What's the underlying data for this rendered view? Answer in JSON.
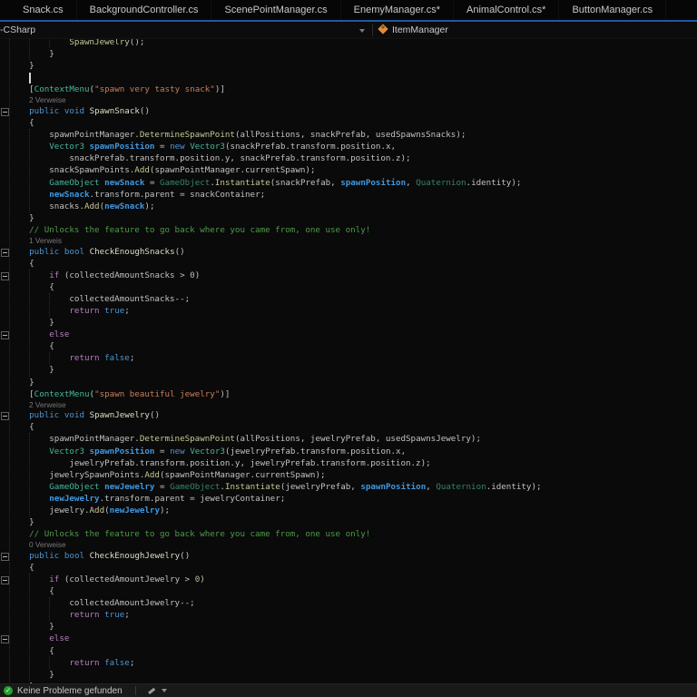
{
  "tab_bar": {
    "tabs": [
      {
        "label": "Snack.cs"
      },
      {
        "label": "BackgroundController.cs"
      },
      {
        "label": "ScenePointManager.cs"
      },
      {
        "label": "EnemyManager.cs*"
      },
      {
        "label": "AnimalControl.cs*"
      },
      {
        "label": "ButtonManager.cs"
      }
    ]
  },
  "nav_bar": {
    "project_dropdown": "-CSharp",
    "type_dropdown": "ItemManager"
  },
  "status_bar": {
    "message": "Keine Probleme gefunden"
  },
  "colors": {
    "accent_blue": "#1d59a6",
    "class_icon_orange": "#dd8f3d",
    "status_green": "#27a12f",
    "tokens": {
      "p": "#c2c2c2",
      "k": "#4e94cf",
      "c": "#b77fc1",
      "t": "#45b89c",
      "td": "#37836f",
      "m": "#c6c795",
      "md": "#dedec8",
      "l": "#4098e0",
      "s": "#c77d5f",
      "cm": "#4e9a4a",
      "n": "#a9c49a",
      "lens": "#787878"
    }
  },
  "editor": {
    "caret_line": 4,
    "fold_lines": [
      7,
      19,
      21,
      26,
      33,
      45,
      47,
      52
    ],
    "guides": [
      {
        "col": 0,
        "from": 1,
        "to": null
      },
      {
        "col": 4,
        "from": 1,
        "to": 3
      },
      {
        "col": 8,
        "from": 1,
        "to": 2
      },
      {
        "col": 4,
        "from": 9,
        "to": 16
      },
      {
        "col": 4,
        "from": 21,
        "to": 30
      },
      {
        "col": 4,
        "from": 35,
        "to": 42
      },
      {
        "col": 4,
        "from": 47,
        "to": 56
      },
      {
        "col": 8,
        "from": 23,
        "to": 25
      },
      {
        "col": 8,
        "from": 28,
        "to": 29
      },
      {
        "col": 8,
        "from": 49,
        "to": 51
      },
      {
        "col": 8,
        "from": 54,
        "to": 55
      }
    ],
    "lines": [
      {
        "kind": "code",
        "tokens": [
          [
            "p",
            "            "
          ],
          [
            "m",
            "SpawnJewelry"
          ],
          [
            "p",
            "();"
          ]
        ]
      },
      {
        "kind": "code",
        "tokens": [
          [
            "p",
            "        }"
          ]
        ]
      },
      {
        "kind": "code",
        "tokens": [
          [
            "p",
            "    }"
          ]
        ]
      },
      {
        "kind": "code",
        "tokens": []
      },
      {
        "kind": "code",
        "tokens": [
          [
            "p",
            "    ["
          ],
          [
            "t",
            "ContextMenu"
          ],
          [
            "p",
            "("
          ],
          [
            "s",
            "\"spawn very tasty snack\""
          ],
          [
            "p",
            ")]"
          ]
        ]
      },
      {
        "kind": "lens",
        "text": "2 Verweise"
      },
      {
        "kind": "code",
        "tokens": [
          [
            "p",
            "    "
          ],
          [
            "k",
            "public"
          ],
          [
            "p",
            " "
          ],
          [
            "k",
            "void"
          ],
          [
            "p",
            " "
          ],
          [
            "md",
            "SpawnSnack"
          ],
          [
            "p",
            "()"
          ]
        ]
      },
      {
        "kind": "code",
        "tokens": [
          [
            "p",
            "    {"
          ]
        ]
      },
      {
        "kind": "code",
        "tokens": [
          [
            "p",
            "        spawnPointManager."
          ],
          [
            "m",
            "DetermineSpawnPoint"
          ],
          [
            "p",
            "(allPositions, snackPrefab, usedSpawnsSnacks);"
          ]
        ]
      },
      {
        "kind": "code",
        "tokens": [
          [
            "p",
            "        "
          ],
          [
            "t",
            "Vector3"
          ],
          [
            "p",
            " "
          ],
          [
            "l",
            "spawnPosition"
          ],
          [
            "p",
            " = "
          ],
          [
            "k",
            "new"
          ],
          [
            "p",
            " "
          ],
          [
            "t",
            "Vector3"
          ],
          [
            "p",
            "(snackPrefab.transform.position.x,"
          ]
        ]
      },
      {
        "kind": "code",
        "tokens": [
          [
            "p",
            "            snackPrefab.transform.position.y, snackPrefab.transform.position.z);"
          ]
        ]
      },
      {
        "kind": "code",
        "tokens": [
          [
            "p",
            "        snackSpawnPoints."
          ],
          [
            "m",
            "Add"
          ],
          [
            "p",
            "(spawnPointManager.currentSpawn);"
          ]
        ]
      },
      {
        "kind": "code",
        "tokens": [
          [
            "p",
            "        "
          ],
          [
            "t",
            "GameObject"
          ],
          [
            "p",
            " "
          ],
          [
            "l",
            "newSnack"
          ],
          [
            "p",
            " = "
          ],
          [
            "td",
            "GameObject"
          ],
          [
            "p",
            "."
          ],
          [
            "m",
            "Instantiate"
          ],
          [
            "p",
            "(snackPrefab, "
          ],
          [
            "l",
            "spawnPosition"
          ],
          [
            "p",
            ", "
          ],
          [
            "td",
            "Quaternion"
          ],
          [
            "p",
            ".identity);"
          ]
        ]
      },
      {
        "kind": "code",
        "tokens": [
          [
            "p",
            "        "
          ],
          [
            "l",
            "newSnack"
          ],
          [
            "p",
            ".transform.parent = snackContainer;"
          ]
        ]
      },
      {
        "kind": "code",
        "tokens": [
          [
            "p",
            "        snacks."
          ],
          [
            "m",
            "Add"
          ],
          [
            "p",
            "("
          ],
          [
            "l",
            "newSnack"
          ],
          [
            "p",
            ");"
          ]
        ]
      },
      {
        "kind": "code",
        "tokens": [
          [
            "p",
            "    }"
          ]
        ]
      },
      {
        "kind": "code",
        "tokens": [
          [
            "cm",
            "    // Unlocks the feature to go back where you came from, one use only!"
          ]
        ]
      },
      {
        "kind": "lens",
        "text": "1 Verweis"
      },
      {
        "kind": "code",
        "tokens": [
          [
            "p",
            "    "
          ],
          [
            "k",
            "public"
          ],
          [
            "p",
            " "
          ],
          [
            "k",
            "bool"
          ],
          [
            "p",
            " "
          ],
          [
            "md",
            "CheckEnoughSnacks"
          ],
          [
            "p",
            "()"
          ]
        ]
      },
      {
        "kind": "code",
        "tokens": [
          [
            "p",
            "    {"
          ]
        ]
      },
      {
        "kind": "code",
        "tokens": [
          [
            "p",
            "        "
          ],
          [
            "c",
            "if"
          ],
          [
            "p",
            " (collectedAmountSnacks > "
          ],
          [
            "n",
            "0"
          ],
          [
            "p",
            ")"
          ]
        ]
      },
      {
        "kind": "code",
        "tokens": [
          [
            "p",
            "        {"
          ]
        ]
      },
      {
        "kind": "code",
        "tokens": [
          [
            "p",
            "            collectedAmountSnacks--;"
          ]
        ]
      },
      {
        "kind": "code",
        "tokens": [
          [
            "p",
            "            "
          ],
          [
            "c",
            "return"
          ],
          [
            "p",
            " "
          ],
          [
            "k",
            "true"
          ],
          [
            "p",
            ";"
          ]
        ]
      },
      {
        "kind": "code",
        "tokens": [
          [
            "p",
            "        }"
          ]
        ]
      },
      {
        "kind": "code",
        "tokens": [
          [
            "p",
            "        "
          ],
          [
            "c",
            "else"
          ]
        ]
      },
      {
        "kind": "code",
        "tokens": [
          [
            "p",
            "        {"
          ]
        ]
      },
      {
        "kind": "code",
        "tokens": [
          [
            "p",
            "            "
          ],
          [
            "c",
            "return"
          ],
          [
            "p",
            " "
          ],
          [
            "k",
            "false"
          ],
          [
            "p",
            ";"
          ]
        ]
      },
      {
        "kind": "code",
        "tokens": [
          [
            "p",
            "        }"
          ]
        ]
      },
      {
        "kind": "code",
        "tokens": [
          [
            "p",
            "    }"
          ]
        ]
      },
      {
        "kind": "code",
        "tokens": [
          [
            "p",
            "    ["
          ],
          [
            "t",
            "ContextMenu"
          ],
          [
            "p",
            "("
          ],
          [
            "s",
            "\"spawn beautiful jewelry\""
          ],
          [
            "p",
            ")]"
          ]
        ]
      },
      {
        "kind": "lens",
        "text": "2 Verweise"
      },
      {
        "kind": "code",
        "tokens": [
          [
            "p",
            "    "
          ],
          [
            "k",
            "public"
          ],
          [
            "p",
            " "
          ],
          [
            "k",
            "void"
          ],
          [
            "p",
            " "
          ],
          [
            "md",
            "SpawnJewelry"
          ],
          [
            "p",
            "()"
          ]
        ]
      },
      {
        "kind": "code",
        "tokens": [
          [
            "p",
            "    {"
          ]
        ]
      },
      {
        "kind": "code",
        "tokens": [
          [
            "p",
            "        spawnPointManager."
          ],
          [
            "m",
            "DetermineSpawnPoint"
          ],
          [
            "p",
            "(allPositions, jewelryPrefab, usedSpawnsJewelry);"
          ]
        ]
      },
      {
        "kind": "code",
        "tokens": [
          [
            "p",
            "        "
          ],
          [
            "t",
            "Vector3"
          ],
          [
            "p",
            " "
          ],
          [
            "l",
            "spawnPosition"
          ],
          [
            "p",
            " = "
          ],
          [
            "k",
            "new"
          ],
          [
            "p",
            " "
          ],
          [
            "t",
            "Vector3"
          ],
          [
            "p",
            "(jewelryPrefab.transform.position.x,"
          ]
        ]
      },
      {
        "kind": "code",
        "tokens": [
          [
            "p",
            "            jewelryPrefab.transform.position.y, jewelryPrefab.transform.position.z);"
          ]
        ]
      },
      {
        "kind": "code",
        "tokens": [
          [
            "p",
            "        jewelrySpawnPoints."
          ],
          [
            "m",
            "Add"
          ],
          [
            "p",
            "(spawnPointManager.currentSpawn);"
          ]
        ]
      },
      {
        "kind": "code",
        "tokens": [
          [
            "p",
            "        "
          ],
          [
            "t",
            "GameObject"
          ],
          [
            "p",
            " "
          ],
          [
            "l",
            "newJewelry"
          ],
          [
            "p",
            " = "
          ],
          [
            "td",
            "GameObject"
          ],
          [
            "p",
            "."
          ],
          [
            "m",
            "Instantiate"
          ],
          [
            "p",
            "(jewelryPrefab, "
          ],
          [
            "l",
            "spawnPosition"
          ],
          [
            "p",
            ", "
          ],
          [
            "td",
            "Quaternion"
          ],
          [
            "p",
            ".identity);"
          ]
        ]
      },
      {
        "kind": "code",
        "tokens": [
          [
            "p",
            "        "
          ],
          [
            "l",
            "newJewelry"
          ],
          [
            "p",
            ".transform.parent = jewelryContainer;"
          ]
        ]
      },
      {
        "kind": "code",
        "tokens": [
          [
            "p",
            "        jewelry."
          ],
          [
            "m",
            "Add"
          ],
          [
            "p",
            "("
          ],
          [
            "l",
            "newJewelry"
          ],
          [
            "p",
            ");"
          ]
        ]
      },
      {
        "kind": "code",
        "tokens": [
          [
            "p",
            "    }"
          ]
        ]
      },
      {
        "kind": "code",
        "tokens": [
          [
            "cm",
            "    // Unlocks the feature to go back where you came from, one use only!"
          ]
        ]
      },
      {
        "kind": "lens",
        "text": "0 Verweise"
      },
      {
        "kind": "code",
        "tokens": [
          [
            "p",
            "    "
          ],
          [
            "k",
            "public"
          ],
          [
            "p",
            " "
          ],
          [
            "k",
            "bool"
          ],
          [
            "p",
            " "
          ],
          [
            "md",
            "CheckEnoughJewelry"
          ],
          [
            "p",
            "()"
          ]
        ]
      },
      {
        "kind": "code",
        "tokens": [
          [
            "p",
            "    {"
          ]
        ]
      },
      {
        "kind": "code",
        "tokens": [
          [
            "p",
            "        "
          ],
          [
            "c",
            "if"
          ],
          [
            "p",
            " (collectedAmountJewelry > "
          ],
          [
            "n",
            "0"
          ],
          [
            "p",
            ")"
          ]
        ]
      },
      {
        "kind": "code",
        "tokens": [
          [
            "p",
            "        {"
          ]
        ]
      },
      {
        "kind": "code",
        "tokens": [
          [
            "p",
            "            collectedAmountJewelry--;"
          ]
        ]
      },
      {
        "kind": "code",
        "tokens": [
          [
            "p",
            "            "
          ],
          [
            "c",
            "return"
          ],
          [
            "p",
            " "
          ],
          [
            "k",
            "true"
          ],
          [
            "p",
            ";"
          ]
        ]
      },
      {
        "kind": "code",
        "tokens": [
          [
            "p",
            "        }"
          ]
        ]
      },
      {
        "kind": "code",
        "tokens": [
          [
            "p",
            "        "
          ],
          [
            "c",
            "else"
          ]
        ]
      },
      {
        "kind": "code",
        "tokens": [
          [
            "p",
            "        {"
          ]
        ]
      },
      {
        "kind": "code",
        "tokens": [
          [
            "p",
            "            "
          ],
          [
            "c",
            "return"
          ],
          [
            "p",
            " "
          ],
          [
            "k",
            "false"
          ],
          [
            "p",
            ";"
          ]
        ]
      },
      {
        "kind": "code",
        "tokens": [
          [
            "p",
            "        }"
          ]
        ]
      },
      {
        "kind": "code",
        "tokens": [
          [
            "p",
            "    }"
          ]
        ]
      }
    ]
  }
}
